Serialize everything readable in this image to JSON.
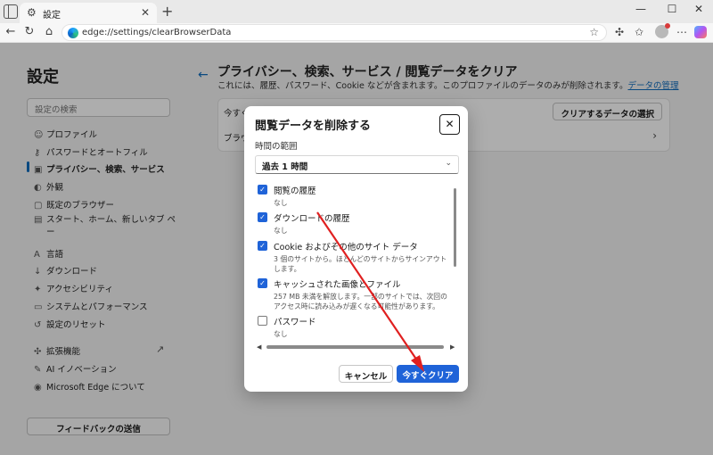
{
  "browser": {
    "tab_title": "設定",
    "url": "edge://settings/clearBrowserData",
    "new_tab": "+",
    "tab_close": "✕",
    "window_controls": [
      "—",
      "☐",
      "✕"
    ]
  },
  "sidebar": {
    "title": "設定",
    "search_placeholder": "設定の検索",
    "items": [
      {
        "label": "プロファイル",
        "icon": "person-icon"
      },
      {
        "label": "パスワードとオートフィル",
        "icon": "key-icon"
      },
      {
        "label": "プライバシー、検索、サービス",
        "icon": "lock-icon",
        "active": true
      },
      {
        "label": "外観",
        "icon": "appearance-icon"
      },
      {
        "label": "既定のブラウザー",
        "icon": "browser-icon"
      },
      {
        "label": "スタート、ホーム、新しいタブ ペ",
        "icon": "home-icon"
      },
      {
        "label": "ー",
        "icon": ""
      },
      {
        "label": "言語",
        "icon": "language-icon"
      },
      {
        "label": "ダウンロード",
        "icon": "download-icon"
      },
      {
        "label": "アクセシビリティ",
        "icon": "accessibility-icon"
      },
      {
        "label": "システムとパフォーマンス",
        "icon": "system-icon"
      },
      {
        "label": "設定のリセット",
        "icon": "reset-icon"
      },
      {
        "label": "拡張機能",
        "icon": "extensions-icon"
      },
      {
        "label": "AI イノベーション",
        "icon": "ai-icon"
      },
      {
        "label": "Microsoft Edge について",
        "icon": "edge-icon"
      }
    ],
    "feedback_label": "フィードバックの送信"
  },
  "main": {
    "title": "プライバシー、検索、サービス / 閲覧データをクリア",
    "subtitle": "これには、履歴、パスワード、Cookie などが含まれます。このプロファイルのデータのみが削除されます。",
    "manage_link": "データの管理",
    "row1_label": "今すぐ",
    "row2_label": "ブラウ",
    "choose_button": "クリアするデータの選択"
  },
  "dialog": {
    "title": "閲覧データを削除する",
    "close": "✕",
    "range_label": "時間の範囲",
    "range_value": "過去 1 時間",
    "options": [
      {
        "label": "閲覧の履歴",
        "desc": "なし",
        "checked": true
      },
      {
        "label": "ダウンロードの履歴",
        "desc": "なし",
        "checked": true
      },
      {
        "label": "Cookie およびその他のサイト データ",
        "desc": "3 個のサイトから。ほとんどのサイトからサインアウトします。",
        "checked": true
      },
      {
        "label": "キャッシュされた画像とファイル",
        "desc": "257 MB 未満を解放します。一部のサイトでは、次回のアクセス時に読み込みが遅くなる可能性があります。",
        "checked": true
      },
      {
        "label": "パスワード",
        "desc": "なし",
        "checked": false
      }
    ],
    "cancel_button": "キャンセル",
    "clear_button": "今すぐクリア"
  },
  "colors": {
    "accent": "#1f63d8",
    "link": "#0f6cbd",
    "annotation_arrow": "#e02020"
  }
}
